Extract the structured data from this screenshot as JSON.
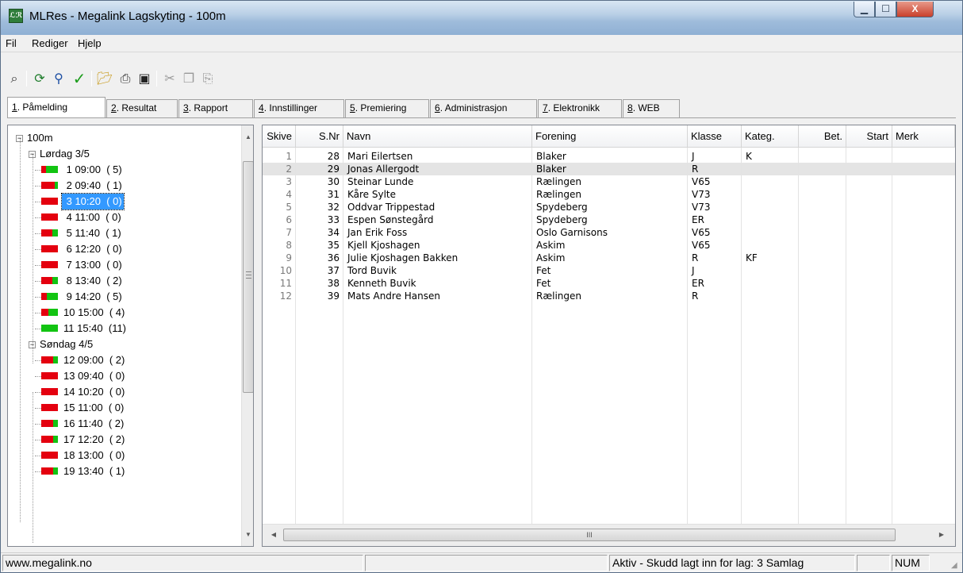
{
  "window": {
    "app_icon_text": "ℒℛ",
    "title": "MLRes - Megalink Lagskyting - 100m",
    "minimize": "▁",
    "maximize": "☐",
    "close": "X"
  },
  "menu": [
    "Fil",
    "Rediger",
    "Hjelp"
  ],
  "toolbar": {
    "icons": [
      "lasso-icon",
      "refresh-icon",
      "search-icon",
      "check-icon",
      "open-folder-icon",
      "print-icon",
      "save-icon",
      "cut-icon",
      "copy-icon",
      "paste-icon"
    ]
  },
  "tabs": [
    {
      "key": "1",
      "label": ". Påmelding",
      "active": true
    },
    {
      "key": "2",
      "label": ". Resultat"
    },
    {
      "key": "3",
      "label": ". Rapport"
    },
    {
      "key": "4",
      "label": ". Innstillinger"
    },
    {
      "key": "5",
      "label": ". Premiering"
    },
    {
      "key": "6",
      "label": ". Administrasjon"
    },
    {
      "key": "7",
      "label": ". Elektronikk"
    },
    {
      "key": "8",
      "label": ". WEB"
    }
  ],
  "tree": {
    "root": "100m",
    "days": [
      {
        "label": "Lørdag 3/5",
        "lags": [
          {
            "label": " 1 09:00  ( 5)",
            "fill": 0.7
          },
          {
            "label": " 2 09:40  ( 1)",
            "fill": 0.2
          },
          {
            "label": " 3 10:20  ( 0)",
            "fill": 0.0,
            "selected": true
          },
          {
            "label": " 4 11:00  ( 0)",
            "fill": 0.0
          },
          {
            "label": " 5 11:40  ( 1)",
            "fill": 0.35
          },
          {
            "label": " 6 12:20  ( 0)",
            "fill": 0.0
          },
          {
            "label": " 7 13:00  ( 0)",
            "fill": 0.0
          },
          {
            "label": " 8 13:40  ( 2)",
            "fill": 0.35
          },
          {
            "label": " 9 14:20  ( 5)",
            "fill": 0.65
          },
          {
            "label": "10 15:00  ( 4)",
            "fill": 0.55
          },
          {
            "label": "11 15:40  (11)",
            "fill": 1.0
          }
        ]
      },
      {
        "label": "Søndag 4/5",
        "lags": [
          {
            "label": "12 09:00  ( 2)",
            "fill": 0.3
          },
          {
            "label": "13 09:40  ( 0)",
            "fill": 0.0
          },
          {
            "label": "14 10:20  ( 0)",
            "fill": 0.0
          },
          {
            "label": "15 11:00  ( 0)",
            "fill": 0.0
          },
          {
            "label": "16 11:40  ( 2)",
            "fill": 0.3
          },
          {
            "label": "17 12:20  ( 2)",
            "fill": 0.3
          },
          {
            "label": "18 13:00  ( 0)",
            "fill": 0.0
          },
          {
            "label": "19 13:40  ( 1)",
            "fill": 0.3
          }
        ]
      }
    ]
  },
  "grid": {
    "columns": [
      "Skive",
      "S.Nr",
      "Navn",
      "Forening",
      "Klasse",
      "Kateg.",
      "Bet.",
      "Start",
      "Merk"
    ],
    "rows": [
      [
        "1",
        "28",
        "Mari Eilertsen",
        "Blaker",
        "J",
        "K"
      ],
      [
        "2",
        "29",
        "Jonas Allergodt",
        "Blaker",
        "R",
        ""
      ],
      [
        "3",
        "30",
        "Steinar Lunde",
        "Rælingen",
        "V65",
        ""
      ],
      [
        "4",
        "31",
        "Kåre Sylte",
        "Rælingen",
        "V73",
        ""
      ],
      [
        "5",
        "32",
        "Oddvar Trippestad",
        "Spydeberg",
        "V73",
        ""
      ],
      [
        "6",
        "33",
        "Espen Sønstegård",
        "Spydeberg",
        "ER",
        ""
      ],
      [
        "7",
        "34",
        "Jan Erik Foss",
        "Oslo Garnisons",
        "V65",
        ""
      ],
      [
        "8",
        "35",
        "Kjell Kjoshagen",
        "Askim",
        "V65",
        ""
      ],
      [
        "9",
        "36",
        "Julie Kjoshagen Bakken",
        "Askim",
        "R",
        "KF"
      ],
      [
        "10",
        "37",
        "Tord Buvik",
        "Fet",
        "J",
        ""
      ],
      [
        "11",
        "38",
        "Kenneth Buvik",
        "Fet",
        "ER",
        ""
      ],
      [
        "12",
        "39",
        "Mats Andre Hansen",
        "Rælingen",
        "R",
        ""
      ]
    ],
    "hscroll_grip": "III"
  },
  "status": {
    "website": "www.megalink.no",
    "message": "Aktiv - Skudd lagt inn for lag: 3 Samlag",
    "num": "NUM"
  }
}
